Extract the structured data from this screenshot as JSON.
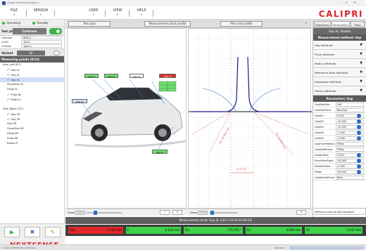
{
  "window": {
    "title": "Gauge Variable Gauging 1"
  },
  "menu": [
    {
      "label": "FILE"
    },
    {
      "label": "SENSOR"
    },
    {
      "label": "USER"
    },
    {
      "label": "VIEW"
    },
    {
      "label": "HELP"
    }
  ],
  "brand": {
    "logo": "CALIPRI",
    "footer_logo": "NEXTSENSE"
  },
  "status": {
    "operating": "Operating",
    "standby": "Standby"
  },
  "testplan": {
    "label": "Test plan",
    "value": "CarGreen",
    "props": [
      {
        "key": "Operator",
        "value": "Shift y"
      },
      {
        "key": "CarID",
        "value": "1024"
      },
      {
        "key": "CarType",
        "value": "Type A"
      }
    ],
    "variant_label": "Variant",
    "variant_value": "All"
  },
  "measuring_points": {
    "header": "Measuring points (0/14)",
    "tree": [
      {
        "text": "Side_Left (0/7)",
        "level": 0,
        "check": false,
        "selected": false
      },
      {
        "text": "Gap 1L",
        "level": 1,
        "check": true,
        "selected": false
      },
      {
        "text": "Gap 2L",
        "level": 1,
        "check": true,
        "selected": false
      },
      {
        "text": "Gap 3L",
        "level": 1,
        "check": true,
        "selected": true
      },
      {
        "text": "SharpGap 4L",
        "level": 1,
        "check": false,
        "selected": false
      },
      {
        "text": "HGap 5L",
        "level": 1,
        "check": false,
        "selected": false
      },
      {
        "text": "FGap 6L",
        "level": 1,
        "check": true,
        "selected": false
      },
      {
        "text": "Radius L",
        "level": 1,
        "check": true,
        "selected": false
      },
      {
        "text": "",
        "level": 0,
        "check": false,
        "selected": false
      },
      {
        "text": "Side_Right (0/7)",
        "level": 0,
        "check": false,
        "selected": false
      },
      {
        "text": "Gap 1R",
        "level": 1,
        "check": true,
        "selected": false
      },
      {
        "text": "Gap 2R",
        "level": 1,
        "check": true,
        "selected": false
      },
      {
        "text": "Gap 3R",
        "level": 1,
        "check": false,
        "selected": false
      },
      {
        "text": "SharpGap 4R",
        "level": 1,
        "check": false,
        "selected": false
      },
      {
        "text": "HGap 5R",
        "level": 1,
        "check": false,
        "selected": false
      },
      {
        "text": "FGap 6R",
        "level": 1,
        "check": false,
        "selected": false
      },
      {
        "text": "Radius R",
        "level": 1,
        "check": false,
        "selected": false
      }
    ]
  },
  "views": {
    "left_tab": "Test plan",
    "middle_tab": "Measurement point profile",
    "right_tab": "Plan and profile",
    "expand": "»",
    "left_zoom_label": "Zoom",
    "left_zoom_value": "122%",
    "right_zoom_label": "Zoom",
    "right_zoom_value": "370%"
  },
  "car_labels": [
    {
      "text": "Gap 1L",
      "color": "#6ee06e"
    },
    {
      "text": "Gap 2L",
      "color": "#6ee06e"
    },
    {
      "text": "Gap 3L",
      "color": "#ffffff"
    },
    {
      "text": "Gap 4L",
      "color": "#e03030"
    },
    {
      "text": "Gap 5L",
      "color": "#cfe0f5"
    },
    {
      "text": "Gap 6L",
      "color": "#6ee06e"
    }
  ],
  "profile_annotations": {
    "r1": "R= 20.000 mm",
    "r2": "d=3.727",
    "r3": "R= 20.000 mm"
  },
  "result": {
    "title": "Measurement result: Gap 3L (2017-04-19 09:49:23)",
    "values": [
      {
        "name": "Gap",
        "value": "3.732 mm",
        "color": "#e02828"
      },
      {
        "name": "F",
        "value": "4.124 mm",
        "color": "#3fd24a"
      },
      {
        "name": "Flu",
        "value": "175.275 °",
        "color": "#3fd24a"
      },
      {
        "name": "R1",
        "value": "3.828 mm",
        "color": "#3fd24a"
      },
      {
        "name": "R2",
        "value": "3.415 mm",
        "color": "#3fd24a"
      }
    ]
  },
  "rightpanel": {
    "tabs": [
      "Properties",
      "Parameters",
      "Plots"
    ],
    "gap_title": "Gap 3L: Presets",
    "method_title": "Measurement method: Gap",
    "attributes": [
      "Gap Attribute",
      "Flush Attribute",
      "Radius Attribute",
      "Reference Data Attribute",
      "Autoshape Attribute",
      "Others Attribute"
    ],
    "params_title": "Parameters: Gap",
    "params": [
      {
        "key": "GapSideSide",
        "value": "Left"
      },
      {
        "key": "GapSideOther",
        "value": "BlueGap"
      },
      {
        "key": "GapSh1",
        "value": "0.000"
      },
      {
        "key": "GapSh2",
        "value": "-10.000"
      },
      {
        "key": "GapSh3",
        "value": "-10.000"
      },
      {
        "key": "GapSh4",
        "value": "-2.000"
      },
      {
        "key": "GapSh5",
        "value": "-2.000"
      },
      {
        "key": "GapFlushMethod",
        "value": "PlMax"
      },
      {
        "key": "GapVarMethod",
        "value": "PlMax"
      },
      {
        "key": "GapNCRate",
        "value": "3.000"
      },
      {
        "key": "EnterPointRight",
        "value": "-90.000"
      },
      {
        "key": "DPrefInPlMax",
        "value": "-0.000"
      },
      {
        "key": "PlMax",
        "value": "-90.000"
      },
      {
        "key": "GapDefaultFocal",
        "value": "Both"
      }
    ],
    "description": "Reference value for gap calculation"
  },
  "statusbar": {
    "left": "Connect: PRESET/Device/Status",
    "right": "Standard"
  }
}
